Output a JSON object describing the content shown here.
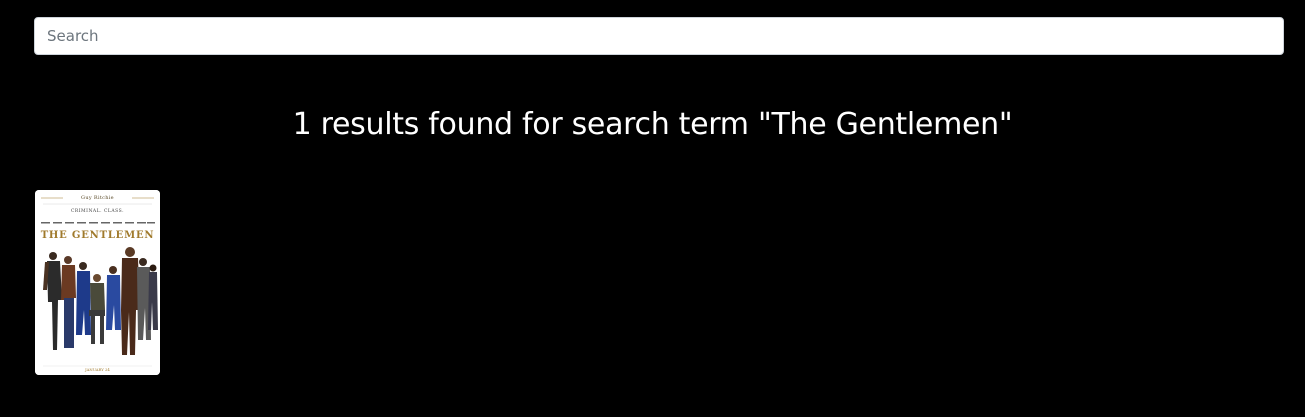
{
  "search": {
    "placeholder": "Search",
    "value": ""
  },
  "results": {
    "heading": "1 results found for search term \"The Gentlemen\"",
    "items": [
      {
        "title": "THE GENTLEMEN",
        "poster": {
          "director_line": "Guy Ritchie",
          "tagline": "CRIMINAL. CLASS.",
          "date": "JANUARY 24"
        }
      }
    ]
  },
  "colors": {
    "background": "#000000",
    "heading_text": "#ffffff",
    "poster_gold": "#a07a2c"
  }
}
